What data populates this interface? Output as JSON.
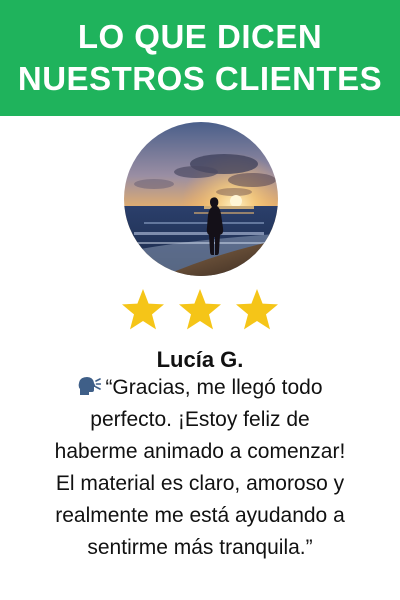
{
  "header": {
    "line1": "LO QUE DICEN",
    "line2": "NUESTROS CLIENTES"
  },
  "colors": {
    "header_bg": "#1fb35c",
    "star": "#f5c518",
    "text": "#111111"
  },
  "icons": {
    "avatar": "customer-photo-sunset-beach",
    "speak": "speaking-head-icon",
    "star": "star-icon"
  },
  "rating": {
    "stars": 3
  },
  "testimonial": {
    "name": "Lucía G.",
    "lines": [
      "“Gracias, me llegó todo",
      "perfecto. ¡Estoy feliz de",
      "haberme animado a comenzar!",
      "El material es claro, amoroso y",
      "realmente me está ayudando a",
      "sentirme más tranquila.”"
    ]
  }
}
